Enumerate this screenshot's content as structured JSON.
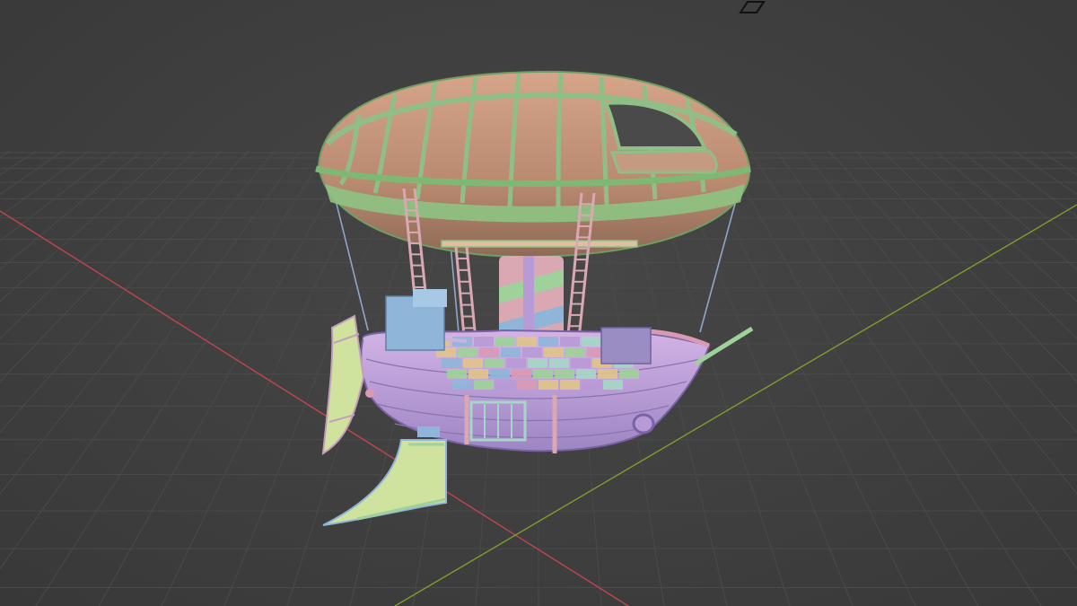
{
  "viewport": {
    "background": "#3d3d3d",
    "grid_color": "#4a4a4a",
    "axis_x_color": "#c0464e",
    "axis_y_color": "#7f9d2e"
  },
  "model": {
    "envelope_color": "#b88a6f",
    "frame_color": "#8fbf86",
    "hull_palette": [
      "#b89ad6",
      "#9fd19a",
      "#e0c48a",
      "#8fb6d9",
      "#d99ab5",
      "#a6d6c7"
    ],
    "fin_color": "#cfe39f",
    "icons": [
      "camera-object-icon"
    ]
  }
}
